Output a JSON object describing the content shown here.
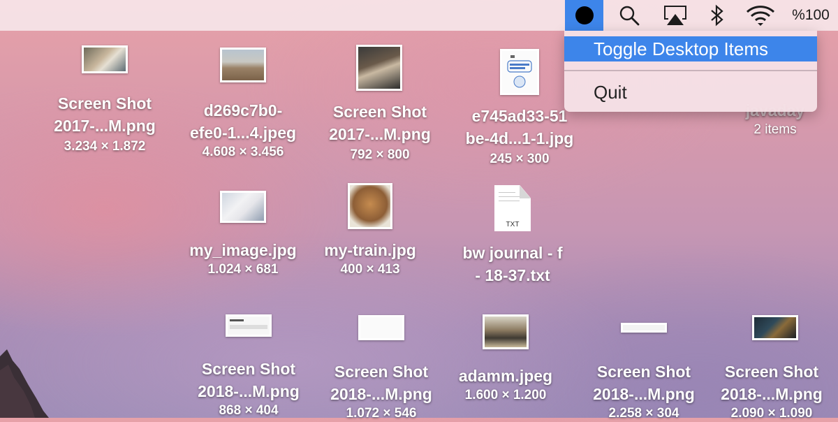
{
  "menubar": {
    "app_icon": "black-circle-icon",
    "search_icon": "magnifier-icon",
    "airplay_icon": "airplay-icon",
    "bluetooth_icon": "bluetooth-icon",
    "wifi_icon": "wifi-icon",
    "battery": "%100"
  },
  "menu": {
    "items": [
      {
        "label": "Toggle Desktop Items",
        "highlighted": true
      },
      {
        "label": "Quit",
        "highlighted": false
      }
    ]
  },
  "desktop": {
    "items": [
      {
        "name1": "Screen Shot",
        "name2": "2017-...M.png",
        "dims": "3.234 × 1.872"
      },
      {
        "name1": "d269c7b0-",
        "name2": "efe0-1...4.jpeg",
        "dims": "4.608 × 3.456"
      },
      {
        "name1": "Screen Shot",
        "name2": "2017-...M.png",
        "dims": "792 × 800"
      },
      {
        "name1": "e745ad33-51",
        "name2": "be-4d...1-1.jpg",
        "dims": "245 × 300"
      },
      {
        "name1": "javaday",
        "name2": "",
        "dims": "2 items"
      },
      {
        "name1": "my_image.jpg",
        "name2": "",
        "dims": "1.024 × 681"
      },
      {
        "name1": "my-train.jpg",
        "name2": "",
        "dims": "400 × 413"
      },
      {
        "name1": "bw journal - f",
        "name2": "- 18-37.txt",
        "dims": "",
        "badge": "TXT"
      },
      {
        "name1": "Screen Shot",
        "name2": "2018-...M.png",
        "dims": "868 × 404"
      },
      {
        "name1": "Screen Shot",
        "name2": "2018-...M.png",
        "dims": "1.072 × 546"
      },
      {
        "name1": "adamm.jpeg",
        "name2": "",
        "dims": "1.600 × 1.200"
      },
      {
        "name1": "Screen Shot",
        "name2": "2018-...M.png",
        "dims": "2.258 × 304"
      },
      {
        "name1": "Screen Shot",
        "name2": "2018-...M.png",
        "dims": "2.090 × 1.090"
      }
    ]
  },
  "colors": {
    "accent": "#3d85ea",
    "menubar": "#f6e5e8"
  }
}
